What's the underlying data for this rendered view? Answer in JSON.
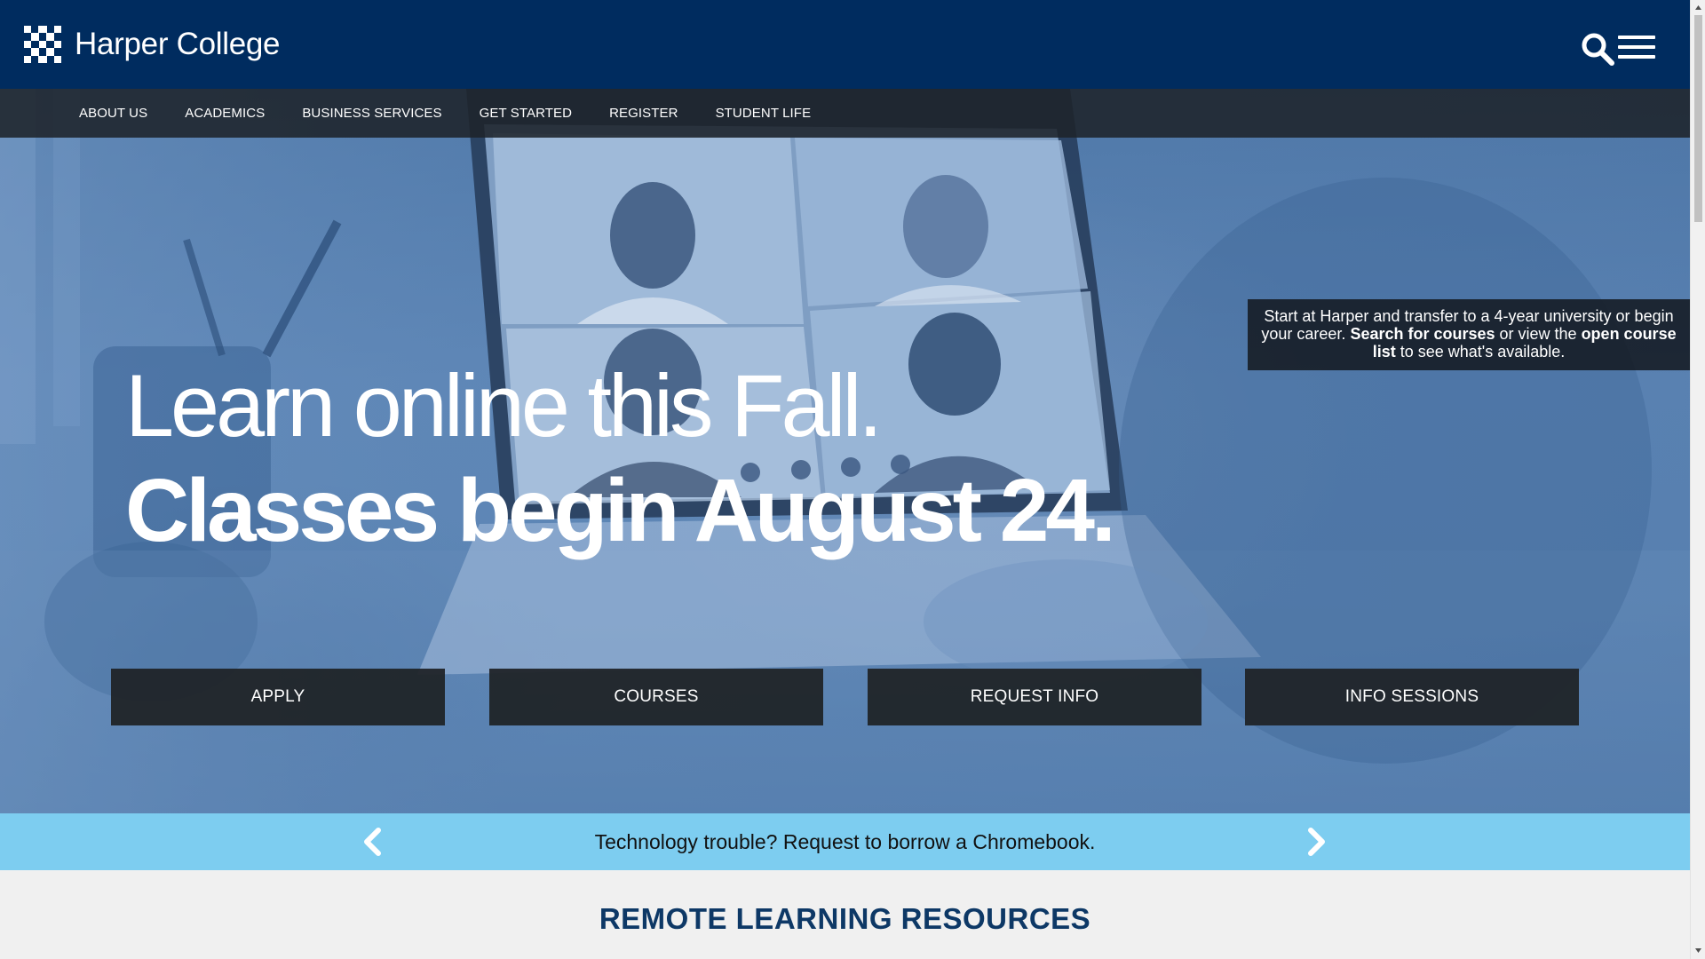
{
  "header": {
    "logo_text": "Harper College",
    "search_icon": "search-icon",
    "menu_icon": "hamburger-menu-icon"
  },
  "nav": {
    "items": [
      {
        "label": "ABOUT US"
      },
      {
        "label": "ACADEMICS"
      },
      {
        "label": "BUSINESS SERVICES"
      },
      {
        "label": "GET STARTED"
      },
      {
        "label": "REGISTER"
      },
      {
        "label": "STUDENT LIFE"
      }
    ]
  },
  "hero": {
    "headline_line1": "Learn online this Fall.",
    "headline_line2": "Classes begin August 24.",
    "info": {
      "part1": "Start at Harper and transfer to a 4-year university or begin your career. ",
      "search_link": "Search for courses",
      "part2": " or view the ",
      "course_list_link": "open course list",
      "part3": " to see what's available."
    },
    "buttons": [
      {
        "label": "APPLY"
      },
      {
        "label": "COURSES"
      },
      {
        "label": "REQUEST INFO"
      },
      {
        "label": "INFO SESSIONS"
      }
    ]
  },
  "ticker": {
    "text": "Technology trouble? Request to borrow a Chromebook.",
    "prev_icon": "chevron-left-icon",
    "next_icon": "chevron-right-icon"
  },
  "section": {
    "title": "REMOTE LEARNING RESOURCES"
  },
  "colors": {
    "header_bg": "#002c5f",
    "ticker_bg": "#7dcdf0",
    "section_title": "#0d3866",
    "cta_bg": "#202428"
  }
}
